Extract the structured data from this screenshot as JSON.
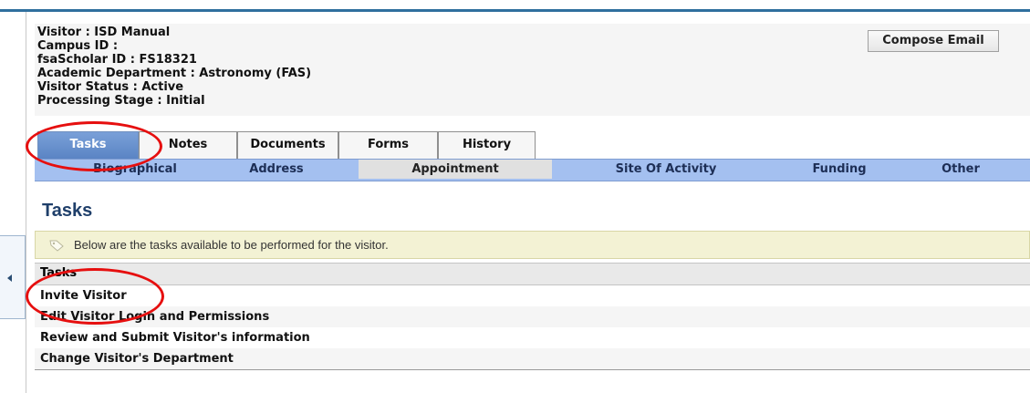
{
  "visitor": {
    "lines": [
      "Visitor : ISD Manual",
      "Campus ID :",
      "fsaScholar ID : FS18321",
      "Academic Department : Astronomy (FAS)",
      "Visitor Status : Active",
      "Processing Stage : Initial"
    ]
  },
  "compose_email": "Compose Email",
  "tabs": [
    {
      "label": "Tasks",
      "active": true
    },
    {
      "label": "Notes",
      "active": false
    },
    {
      "label": "Documents",
      "active": false
    },
    {
      "label": "Forms",
      "active": false
    },
    {
      "label": "History",
      "active": false
    }
  ],
  "subnav": [
    {
      "label": "Biographical",
      "selected": false
    },
    {
      "label": "Address",
      "selected": false
    },
    {
      "label": "Appointment",
      "selected": true
    },
    {
      "label": "Site Of Activity",
      "selected": false
    },
    {
      "label": "Funding",
      "selected": false
    },
    {
      "label": "Other",
      "selected": false
    }
  ],
  "section_title": "Tasks",
  "info_message": "Below are the tasks available to be performed for the visitor.",
  "table": {
    "header": "Tasks",
    "rows": [
      "Invite Visitor",
      "Edit Visitor Login and Permissions",
      "Review and Submit Visitor's information",
      "Change Visitor's Department"
    ]
  },
  "colors": {
    "accent": "#2f6f9e",
    "subnav": "#a4c0f0",
    "highlight_circle": "#e60f0f",
    "heading": "#1f3f6a"
  },
  "icons": [
    "collapse-left-icon",
    "tag-icon",
    "scroll-right-icon"
  ]
}
